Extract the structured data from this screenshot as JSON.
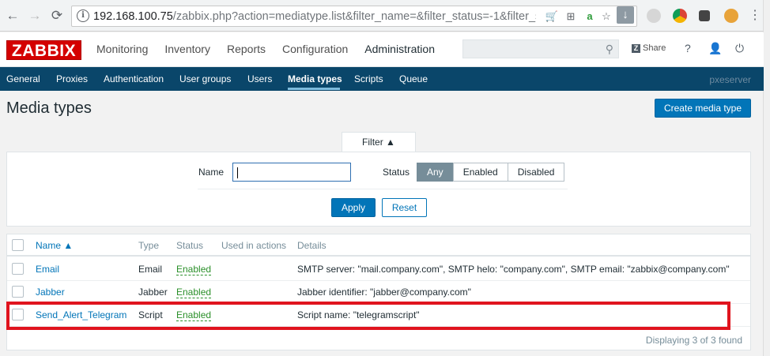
{
  "browser": {
    "url_host": "192.168.100.75",
    "url_path": "/zabbix.php?action=mediatype.list&filter_name=&filter_status=-1&filter_s…"
  },
  "header": {
    "logo": "ZABBIX",
    "menu": [
      "Monitoring",
      "Inventory",
      "Reports",
      "Configuration",
      "Administration"
    ],
    "active_menu": "Administration",
    "share_label": "Share",
    "help_icon": "?"
  },
  "subnav": {
    "items": [
      "General",
      "Proxies",
      "Authentication",
      "User groups",
      "Users",
      "Media types",
      "Scripts",
      "Queue"
    ],
    "selected": "Media types",
    "server_name": "pxeserver"
  },
  "page": {
    "title": "Media types",
    "create_button": "Create media type"
  },
  "filter": {
    "tab_label": "Filter ▲",
    "name_label": "Name",
    "name_value": "",
    "status_label": "Status",
    "status_options": [
      "Any",
      "Enabled",
      "Disabled"
    ],
    "status_selected": "Any",
    "apply_label": "Apply",
    "reset_label": "Reset"
  },
  "table": {
    "headers": {
      "name": "Name ▲",
      "type": "Type",
      "status": "Status",
      "used_in_actions": "Used in actions",
      "details": "Details"
    },
    "rows": [
      {
        "name": "Email",
        "type": "Email",
        "status": "Enabled",
        "used_in_actions": "",
        "details": "SMTP server: \"mail.company.com\", SMTP helo: \"company.com\", SMTP email: \"zabbix@company.com\""
      },
      {
        "name": "Jabber",
        "type": "Jabber",
        "status": "Enabled",
        "used_in_actions": "",
        "details": "Jabber identifier: \"jabber@company.com\""
      },
      {
        "name": "Send_Alert_Telegram",
        "type": "Script",
        "status": "Enabled",
        "used_in_actions": "",
        "details": "Script name: \"telegramscript\""
      }
    ],
    "footer": "Displaying 3 of 3 found"
  },
  "colors": {
    "brand_red": "#d40000",
    "subnav_bg": "#0a466a",
    "primary_button": "#0275b8",
    "enabled_green": "#2a8f29",
    "highlight_red": "#e0141e"
  }
}
